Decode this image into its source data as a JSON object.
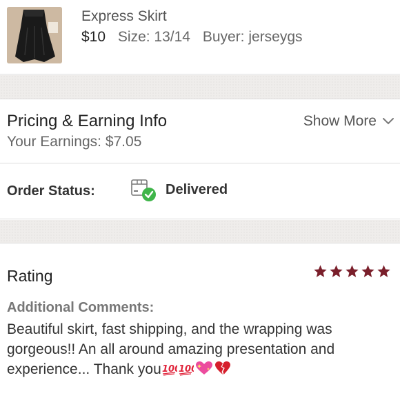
{
  "item": {
    "title": "Express Skirt",
    "price": "$10",
    "size": "Size: 13/14",
    "buyer": "Buyer: jerseygs"
  },
  "pricing": {
    "title": "Pricing & Earning Info",
    "earnings": "Your Earnings: $7.05",
    "show_more": "Show More"
  },
  "order_status": {
    "label": "Order Status:",
    "value": "Delivered"
  },
  "rating": {
    "title": "Rating",
    "stars": 5,
    "star_color": "#7a1f2b",
    "comments_label": "Additional Comments:",
    "comments_text": "Beautiful skirt, fast shipping, and the wrapping was gorgeous!! An all around amazing presentation and experience... Thank you"
  },
  "colors": {
    "separator": "#efedeb",
    "delivered_check": "#3fb54a"
  },
  "icons": {
    "delivered": "package-check-icon",
    "show_more": "chevron-down-icon",
    "emoji": [
      "hundred-points-icon",
      "hundred-points-icon",
      "sparkling-heart-icon",
      "broken-heart-icon"
    ]
  }
}
